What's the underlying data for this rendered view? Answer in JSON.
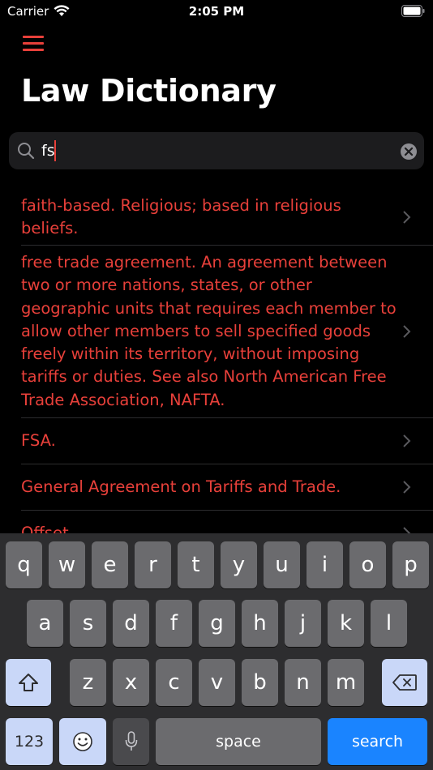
{
  "status_bar": {
    "carrier": "Carrier",
    "time": "2:05 PM"
  },
  "header": {
    "title": "Law Dictionary"
  },
  "search": {
    "value": "fs"
  },
  "results": [
    {
      "lines": [
        "faith-based. Religious; based in religious",
        "beliefs."
      ]
    },
    {
      "lines": [
        "free trade agreement. An agreement between",
        "two or more nations, states, or other",
        "geographic units that requires each member to",
        "allow other members to sell specified goods",
        "freely within its territory, without imposing",
        "tariffs or duties. See also North American Free",
        "Trade Association, NAFTA."
      ]
    },
    {
      "lines": [
        "FSA."
      ]
    },
    {
      "lines": [
        "General Agreement on Tariffs and Trade."
      ]
    },
    {
      "lines": [
        "Offset."
      ]
    }
  ],
  "keyboard": {
    "row1": [
      "q",
      "w",
      "e",
      "r",
      "t",
      "y",
      "u",
      "i",
      "o",
      "p"
    ],
    "row2": [
      "a",
      "s",
      "d",
      "f",
      "g",
      "h",
      "j",
      "k",
      "l"
    ],
    "row3": [
      "z",
      "x",
      "c",
      "v",
      "b",
      "n",
      "m"
    ],
    "numbers_label": "123",
    "space_label": "space",
    "return_label": "search"
  },
  "colors": {
    "accent": "#e8403a",
    "background": "#000000",
    "search_bg": "#1c1c1e",
    "key_bg": "#6b6b6e",
    "return_key": "#1a84ff"
  }
}
